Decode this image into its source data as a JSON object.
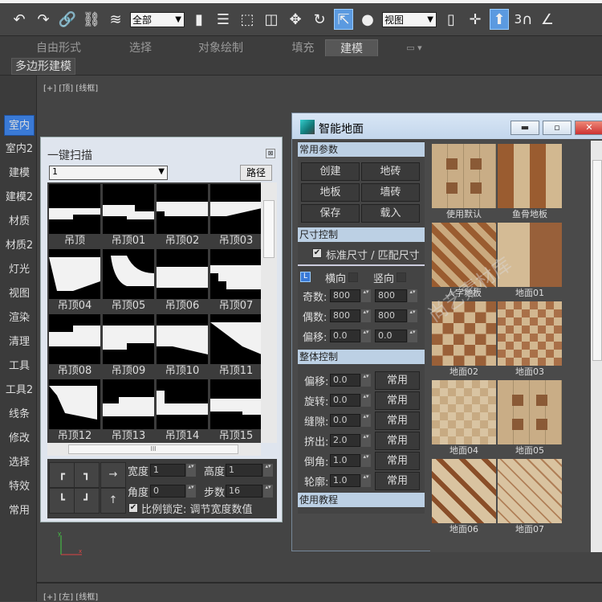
{
  "toolbar": {
    "selection_filter": "全部",
    "coord_system": "视图",
    "snap_label": "3"
  },
  "ribbon": {
    "tabs": [
      "自由形式",
      "选择",
      "对象绘制",
      "填充",
      "建模"
    ],
    "active_tab": "建模",
    "sub_button": "多边形建模"
  },
  "viewports": {
    "top_label": "[+] [顶] [线框]",
    "bottom_label": "[+] [左] [线框]"
  },
  "sidebar": {
    "items": [
      "室内",
      "室内2",
      "建模",
      "建模2",
      "材质",
      "材质2",
      "灯光",
      "视图",
      "渲染",
      "清理",
      "工具",
      "工具2",
      "线条",
      "修改",
      "选择",
      "特效",
      "常用"
    ],
    "active": "室内"
  },
  "sweep_panel": {
    "title": "一键扫描",
    "dropdown_value": "1",
    "path_button": "路径",
    "items": [
      "吊顶",
      "吊顶01",
      "吊顶02",
      "吊顶03",
      "吊顶04",
      "吊顶05",
      "吊顶06",
      "吊顶07",
      "吊顶08",
      "吊顶09",
      "吊顶10",
      "吊顶11",
      "吊顶12",
      "吊顶13",
      "吊顶14",
      "吊顶15"
    ],
    "scroll_thumb_label": "III",
    "width_label": "宽度",
    "width_value": "1",
    "height_label": "高度",
    "height_value": "1",
    "angle_label": "角度",
    "angle_value": "0",
    "steps_label": "步数",
    "steps_value": "16",
    "lock_label": "比例锁定: 调节宽度数值",
    "lock_checked": true,
    "arrow_right": "→",
    "arrow_up": "↑"
  },
  "floor_dialog": {
    "title": "智能地面",
    "sections": {
      "common": "常用参数",
      "size": "尺寸控制",
      "overall": "整体控制",
      "tutorial": "使用教程"
    },
    "buttons": [
      "创建",
      "地砖",
      "地板",
      "墙砖",
      "保存",
      "载入"
    ],
    "std_size_label": "标准尺寸 / 匹配尺寸",
    "std_size_checked": true,
    "l_label": "L",
    "horizontal_label": "横向",
    "vertical_label": "竖向",
    "size_rows": [
      {
        "label": "奇数:",
        "v1": "800",
        "v2": "800"
      },
      {
        "label": "偶数:",
        "v1": "800",
        "v2": "800"
      },
      {
        "label": "偏移:",
        "v1": "0.0",
        "v2": "0.0"
      }
    ],
    "overall_rows": [
      {
        "label": "偏移:",
        "value": "0.0",
        "btn": "常用"
      },
      {
        "label": "旋转:",
        "value": "0.0",
        "btn": "常用"
      },
      {
        "label": "缝隙:",
        "value": "0.0",
        "btn": "常用"
      },
      {
        "label": "挤出:",
        "value": "2.0",
        "btn": "常用"
      },
      {
        "label": "倒角:",
        "value": "1.0",
        "btn": "常用"
      },
      {
        "label": "轮廓:",
        "value": "1.0",
        "btn": "常用"
      }
    ],
    "presets": [
      "使用默认",
      "鱼骨地板",
      "人字地板",
      "地面01",
      "地面02",
      "地面03",
      "地面04",
      "地面05",
      "地面06",
      "地面07"
    ],
    "watermark": "尚艺素材库"
  }
}
